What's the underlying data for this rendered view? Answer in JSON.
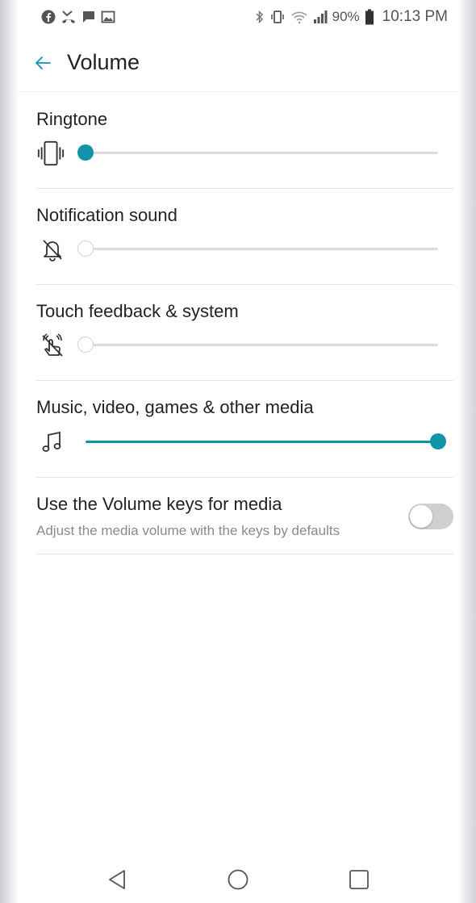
{
  "status_bar": {
    "left_icons": [
      "facebook-icon",
      "missed-call-icon",
      "chat-icon",
      "image-icon"
    ],
    "right_icons": [
      "bluetooth-icon",
      "vibrate-icon",
      "wifi-icon",
      "signal-icon",
      "battery-icon"
    ],
    "battery": "90%",
    "time": "10:13 PM"
  },
  "header": {
    "back_icon": "back-arrow-icon",
    "title": "Volume"
  },
  "sliders": [
    {
      "label": "Ringtone",
      "icon": "vibrate-icon",
      "value": 0.0,
      "muted": false
    },
    {
      "label": "Notification sound",
      "icon": "bell-off-icon",
      "value": 0.0,
      "muted": true
    },
    {
      "label": "Touch feedback & system",
      "icon": "touch-off-icon",
      "value": 0.0,
      "muted": true
    },
    {
      "label": "Music, video, games & other media",
      "icon": "music-note-icon",
      "value": 1.0,
      "muted": false
    }
  ],
  "volume_keys": {
    "title": "Use the Volume keys for media",
    "subtitle": "Adjust the media volume with the keys by defaults",
    "enabled": false
  },
  "nav_bar": [
    "back-icon",
    "home-icon",
    "recents-icon"
  ],
  "colors": {
    "accent": "#1193a8",
    "track": "#dcdcdc",
    "switch_off": "#cfcfcf"
  }
}
